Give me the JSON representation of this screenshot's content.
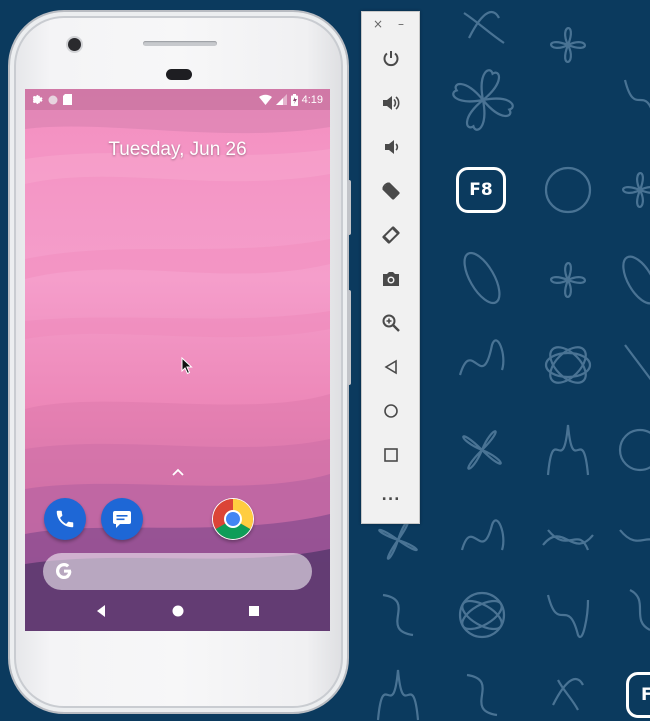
{
  "status_bar": {
    "time": "4:19",
    "left_icons": [
      "settings-icon",
      "circle-icon",
      "sd-card-icon"
    ],
    "right_icons": [
      "wifi-icon",
      "signal-icon",
      "battery-icon"
    ]
  },
  "lock_screen": {
    "date": "Tuesday, Jun 26"
  },
  "dock": {
    "apps": [
      {
        "name": "phone-app-icon",
        "color": "#1e67d6"
      },
      {
        "name": "messages-app-icon",
        "color": "#1e67d6"
      },
      {
        "name": "chrome-app-icon",
        "color": "#ffffff"
      }
    ]
  },
  "search_bar": {
    "icon": "google-g-icon"
  },
  "nav_bar": {
    "buttons": [
      "back-icon",
      "home-icon",
      "recents-icon"
    ]
  },
  "emulator_toolbar": {
    "close_label": "×",
    "minimize_label": "–",
    "more_label": "...",
    "buttons": [
      "power",
      "volume-up",
      "volume-down",
      "rotate-left",
      "rotate-right",
      "screenshot",
      "zoom",
      "back",
      "home",
      "overview",
      "more"
    ]
  },
  "badges": {
    "f8_label": "F8",
    "f8_partial_label": "F"
  },
  "colors": {
    "background": "#0b3a5e",
    "wallpaper_top": "#f497c4",
    "wallpaper_bottom": "#5e3a72",
    "toolbar_icon": "#4a4a4a"
  }
}
